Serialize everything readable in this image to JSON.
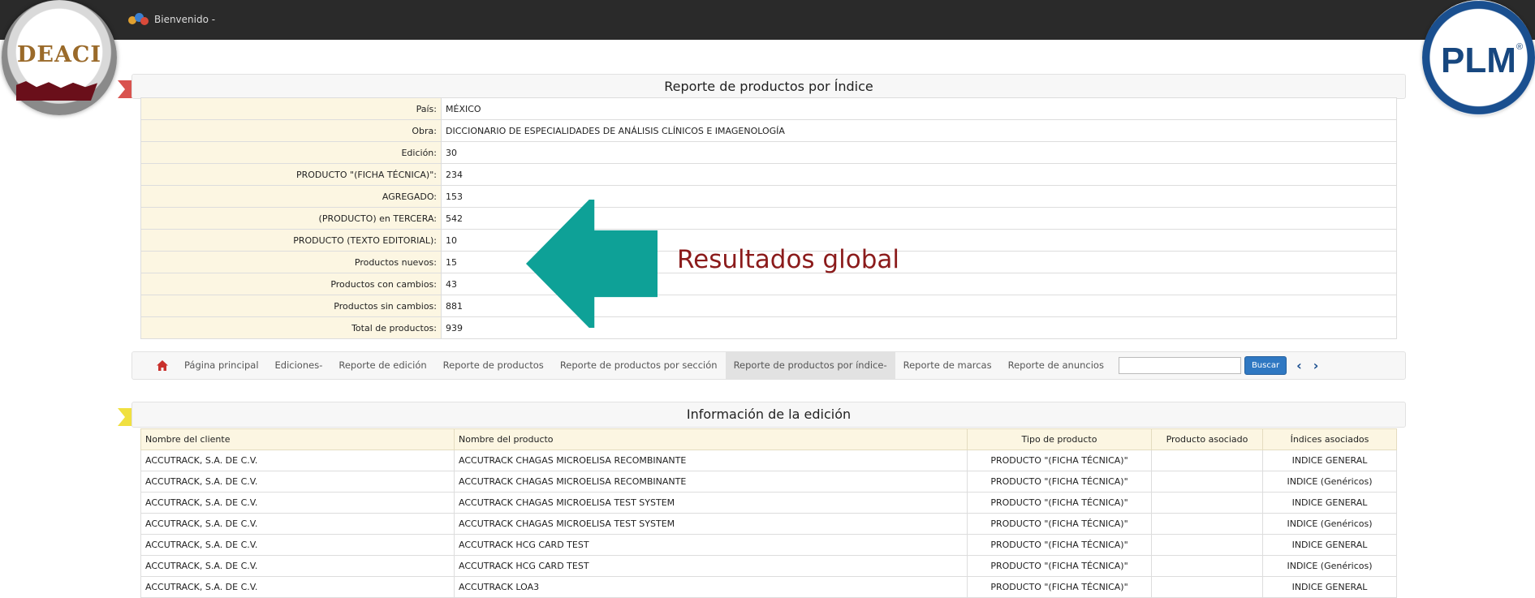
{
  "topbar": {
    "welcome_label": "Bienvenido -"
  },
  "logos": {
    "left": "DEACI",
    "right": "PLM",
    "right_reg": "®"
  },
  "summary": {
    "title": "Reporte de productos por Índice",
    "rows": [
      {
        "label": "País:",
        "value": "MÉXICO"
      },
      {
        "label": "Obra:",
        "value": "DICCIONARIO DE ESPECIALIDADES DE ANÁLISIS CLÍNICOS E IMAGENOLOGÍA"
      },
      {
        "label": "Edición:",
        "value": "30"
      },
      {
        "label": "PRODUCTO \"(FICHA TÉCNICA)\":",
        "value": "234"
      },
      {
        "label": "AGREGADO:",
        "value": "153"
      },
      {
        "label": "(PRODUCTO) en TERCERA:",
        "value": "542"
      },
      {
        "label": "PRODUCTO (TEXTO EDITORIAL):",
        "value": "10"
      },
      {
        "label": "Productos nuevos:",
        "value": "15"
      },
      {
        "label": "Productos con cambios:",
        "value": "43"
      },
      {
        "label": "Productos sin cambios:",
        "value": "881"
      },
      {
        "label": "Total de productos:",
        "value": "939"
      }
    ]
  },
  "annotation": {
    "text": "Resultados global",
    "color": "#8b1b1b",
    "arrow_color": "#0ea197"
  },
  "nav": {
    "items": [
      "Página principal",
      "Ediciones-",
      "Reporte de edición",
      "Reporte de productos",
      "Reporte de productos por sección",
      "Reporte de productos por índice-",
      "Reporte de marcas",
      "Reporte de anuncios"
    ],
    "search_placeholder": "",
    "search_button": "Buscar"
  },
  "info": {
    "title": "Información de la edición",
    "columns": [
      "Nombre del cliente",
      "Nombre del producto",
      "Tipo de producto",
      "Producto asociado",
      "Índices asociados"
    ],
    "rows": [
      [
        "ACCUTRACK, S.A. DE C.V.",
        "ACCUTRACK CHAGAS MICROELISA RECOMBINANTE",
        "PRODUCTO \"(FICHA TÉCNICA)\"",
        "",
        "INDICE GENERAL"
      ],
      [
        "ACCUTRACK, S.A. DE C.V.",
        "ACCUTRACK CHAGAS MICROELISA RECOMBINANTE",
        "PRODUCTO \"(FICHA TÉCNICA)\"",
        "",
        "INDICE (Genéricos)"
      ],
      [
        "ACCUTRACK, S.A. DE C.V.",
        "ACCUTRACK CHAGAS MICROELISA TEST SYSTEM",
        "PRODUCTO \"(FICHA TÉCNICA)\"",
        "",
        "INDICE GENERAL"
      ],
      [
        "ACCUTRACK, S.A. DE C.V.",
        "ACCUTRACK CHAGAS MICROELISA TEST SYSTEM",
        "PRODUCTO \"(FICHA TÉCNICA)\"",
        "",
        "INDICE (Genéricos)"
      ],
      [
        "ACCUTRACK, S.A. DE C.V.",
        "ACCUTRACK HCG CARD TEST",
        "PRODUCTO \"(FICHA TÉCNICA)\"",
        "",
        "INDICE GENERAL"
      ],
      [
        "ACCUTRACK, S.A. DE C.V.",
        "ACCUTRACK HCG CARD TEST",
        "PRODUCTO \"(FICHA TÉCNICA)\"",
        "",
        "INDICE (Genéricos)"
      ],
      [
        "ACCUTRACK, S.A. DE C.V.",
        "ACCUTRACK LOA3",
        "PRODUCTO \"(FICHA TÉCNICA)\"",
        "",
        "INDICE GENERAL"
      ]
    ]
  },
  "colors": {
    "topbar": "#2a2a2a",
    "key_bg": "#fcf6e2",
    "button": "#2f78c2",
    "flag_red": "#d9534f",
    "flag_yellow": "#f0e040"
  }
}
